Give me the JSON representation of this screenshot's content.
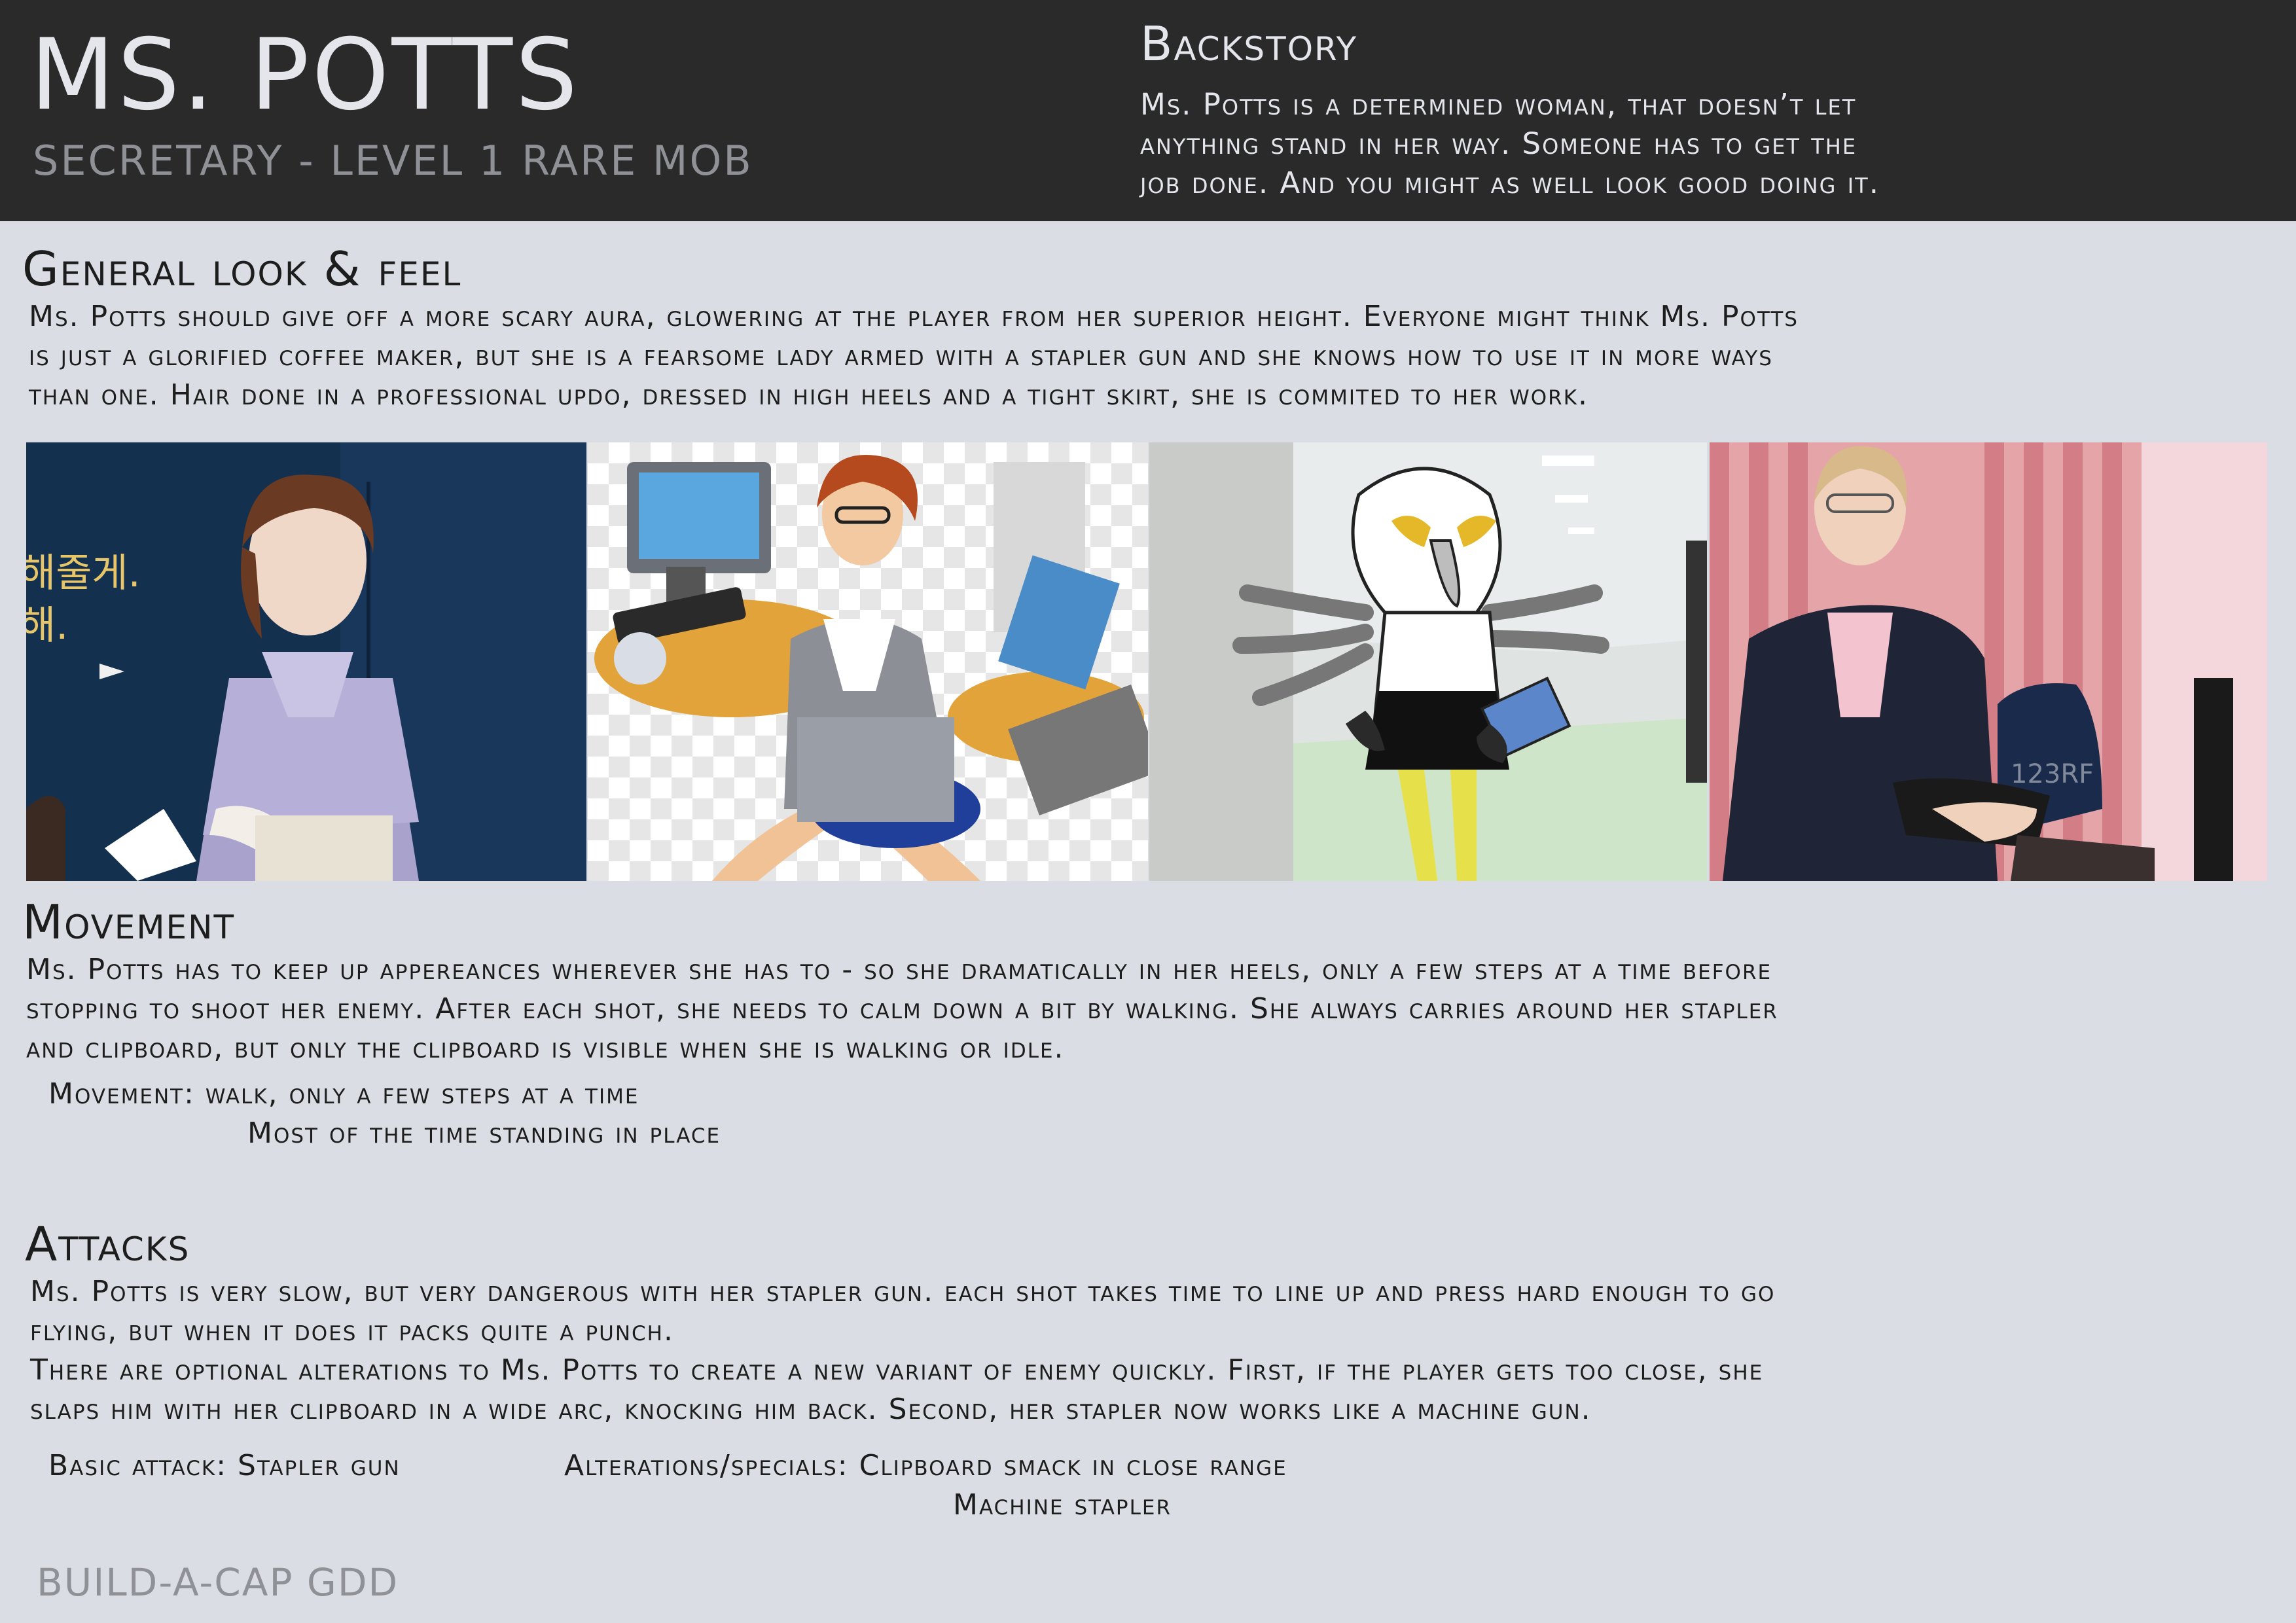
{
  "header": {
    "title": "MS. POTTS",
    "subtitle": "SECRETARY - LEVEL 1 RARE MOB",
    "backstory_heading": "Backstory",
    "backstory_text": "Ms. Potts is a determined woman, that doesn’t let\nanything stand in her way. Someone has to get the\njob done. And you might as well look good doing it."
  },
  "look": {
    "heading": "General look & feel",
    "text": "Ms. Potts should give off a more scary aura, glowering at the player from her superior height. Everyone might think Ms. Potts\nis just a glorified coffee maker, but she is a fearsome lady armed with a stapler gun and she knows how to use it in more ways\nthan one. Hair done in a professional updo, dressed in high heels and a tight skirt, she is commited to her work."
  },
  "movement": {
    "heading": "Movement",
    "text": "Ms. Potts has to keep up appereances wherever she has to - so she dramatically in her heels, only a few steps at a time before\nstopping to shoot her enemy. After each shot, she needs to calm down a bit by walking. She always carries around her stapler\nand clipboard, but only the clipboard is visible when she is walking or idle.",
    "detail_label": "Movement: walk, only a few steps at a time",
    "detail_line2": "Most of the time standing in place"
  },
  "attacks": {
    "heading": "Attacks",
    "text": "Ms. Potts is very slow, but very dangerous with her stapler gun. each shot takes time to line up and press hard enough to go\nflying, but when it does it packs quite a punch.\nThere are optional alterations to Ms. Potts to create a new variant of enemy quickly. First, if the player gets too close, she\nslaps him with her clipboard in a wide arc, knocking him back. Second, her stapler now works like a machine gun.",
    "basic": "Basic attack: Stapler gun",
    "alterations": "Alterations/specials: Clipboard smack in close range",
    "alterations_line2": "Machine stapler"
  },
  "images": {
    "image1_text": "해줄게.\n해.",
    "image2_text": "",
    "image4_watermark": "123RF"
  },
  "footer": {
    "label": "BUILD-A-CAP GDD"
  },
  "colors": {
    "header_bg": "#2a2a2a",
    "page_bg": "#dadee4",
    "title": "#e4e6ec",
    "muted": "#8f9196"
  }
}
